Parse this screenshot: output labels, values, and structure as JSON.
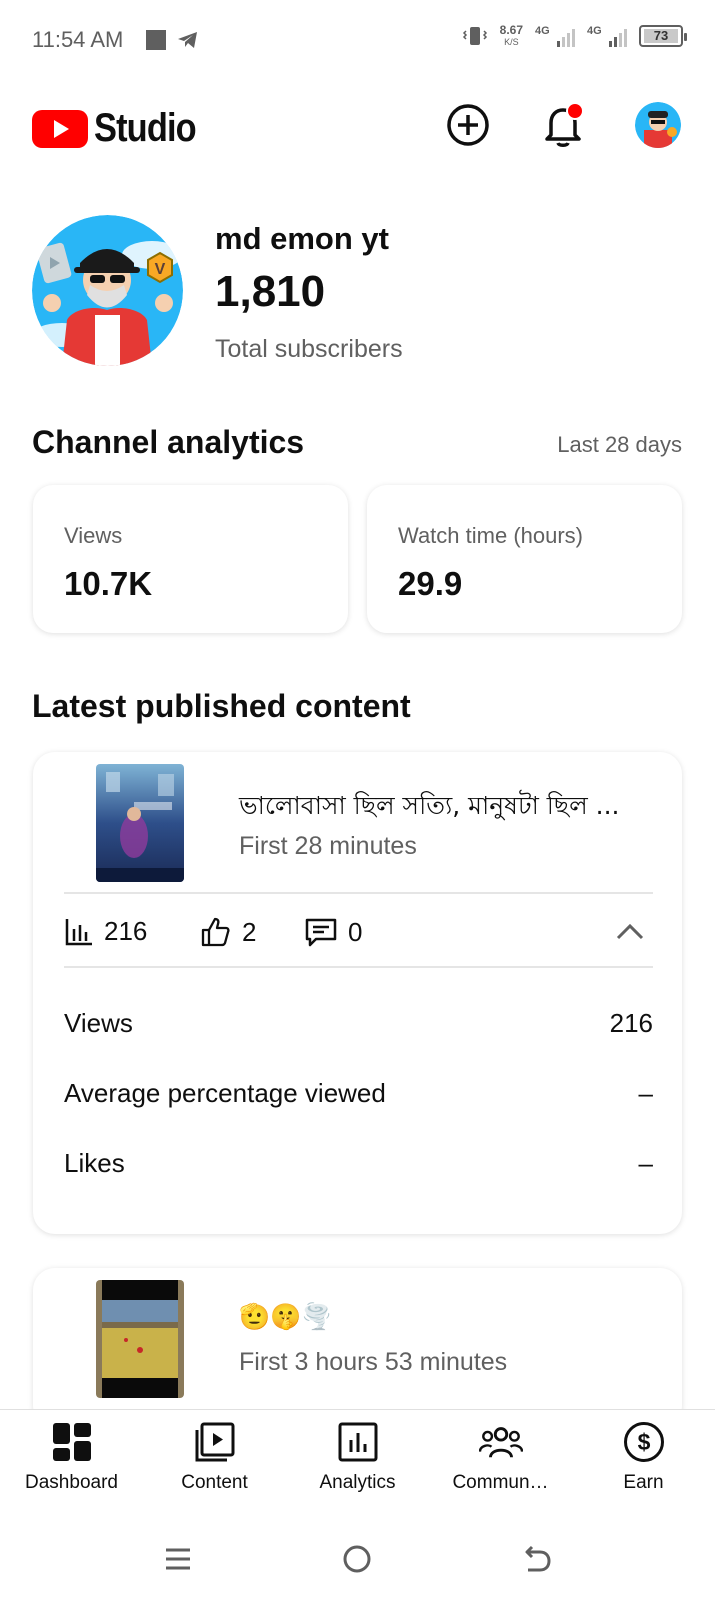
{
  "status_bar": {
    "time": "11:54 AM",
    "net_speed": "8.67",
    "net_unit": "K/S",
    "signal1": "4G",
    "signal2": "4G",
    "battery": "73"
  },
  "header": {
    "brand": "Studio",
    "create_icon": "plus-circle-icon",
    "notification_icon": "bell-icon",
    "notification_badge_color": "#ff0000"
  },
  "channel": {
    "name": "md emon yt",
    "subscribers": "1,810",
    "subscribers_label": "Total subscribers"
  },
  "analytics": {
    "title": "Channel analytics",
    "period": "Last 28 days",
    "cards": [
      {
        "label": "Views",
        "value": "10.7K"
      },
      {
        "label": "Watch time (hours)",
        "value": "29.9"
      }
    ]
  },
  "latest": {
    "title": "Latest published content",
    "items": [
      {
        "title": "ভালোবাসা ছিল সত্যি, মানুষটা ছিল ...",
        "subtitle": "First 28 minutes",
        "views": "216",
        "likes": "2",
        "comments": "0",
        "details": [
          {
            "label": "Views",
            "value": "216"
          },
          {
            "label": "Average percentage viewed",
            "value": "–"
          },
          {
            "label": "Likes",
            "value": "–"
          }
        ]
      },
      {
        "title": "🫡🤫🌪️",
        "subtitle": "First 3 hours 53 minutes"
      }
    ]
  },
  "bottom_nav": [
    {
      "label": "Dashboard",
      "icon": "dashboard-icon"
    },
    {
      "label": "Content",
      "icon": "content-icon"
    },
    {
      "label": "Analytics",
      "icon": "analytics-icon"
    },
    {
      "label": "Commun…",
      "icon": "community-icon"
    },
    {
      "label": "Earn",
      "icon": "earn-icon"
    }
  ],
  "colors": {
    "brand_red": "#ff0000",
    "text_primary": "#0f0f0f",
    "text_secondary": "#606060"
  }
}
